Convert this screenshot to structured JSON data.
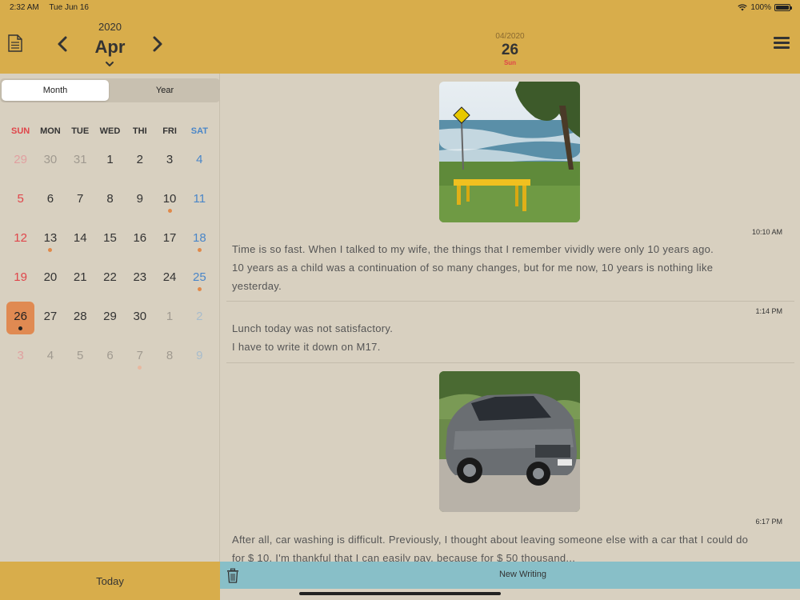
{
  "status_bar": {
    "time": "2:32 AM",
    "date": "Tue Jun 16",
    "battery": "100%",
    "battery_level": 1.0
  },
  "calendar": {
    "year": "2020",
    "month": "Apr",
    "segments": [
      "Month",
      "Year"
    ],
    "active_segment": "Month",
    "weekdays": [
      "SUN",
      "MON",
      "TUE",
      "WED",
      "THI",
      "FRI",
      "SAT"
    ],
    "weeks": [
      [
        {
          "d": "29",
          "o": true
        },
        {
          "d": "30",
          "o": true
        },
        {
          "d": "31",
          "o": true
        },
        {
          "d": "1"
        },
        {
          "d": "2"
        },
        {
          "d": "3"
        },
        {
          "d": "4"
        }
      ],
      [
        {
          "d": "5"
        },
        {
          "d": "6"
        },
        {
          "d": "7"
        },
        {
          "d": "8"
        },
        {
          "d": "9"
        },
        {
          "d": "10",
          "dot": true
        },
        {
          "d": "11"
        }
      ],
      [
        {
          "d": "12"
        },
        {
          "d": "13",
          "dot": true
        },
        {
          "d": "14"
        },
        {
          "d": "15"
        },
        {
          "d": "16"
        },
        {
          "d": "17"
        },
        {
          "d": "18",
          "dot": true
        }
      ],
      [
        {
          "d": "19"
        },
        {
          "d": "20"
        },
        {
          "d": "21"
        },
        {
          "d": "22"
        },
        {
          "d": "23"
        },
        {
          "d": "24"
        },
        {
          "d": "25",
          "dot": true
        }
      ],
      [
        {
          "d": "26",
          "dot": true,
          "sel": true
        },
        {
          "d": "27"
        },
        {
          "d": "28"
        },
        {
          "d": "29"
        },
        {
          "d": "30"
        },
        {
          "d": "1",
          "o": true
        },
        {
          "d": "2",
          "o": true
        }
      ],
      [
        {
          "d": "3",
          "o": true
        },
        {
          "d": "4",
          "o": true
        },
        {
          "d": "5",
          "o": true
        },
        {
          "d": "6",
          "o": true
        },
        {
          "d": "7",
          "o": true,
          "dot": true
        },
        {
          "d": "8",
          "o": true
        },
        {
          "d": "9",
          "o": true
        }
      ]
    ],
    "today_label": "Today"
  },
  "header": {
    "date_small": "04/2020",
    "date_big": "26",
    "day": "Sun"
  },
  "entries": [
    {
      "time": "10:10 AM",
      "text_lines": [
        "Time is so fast. When I talked to my wife, the things that I remember vividly were only 10 years ago.",
        "10 years as a child was a continuation of so many changes, but for me now, 10 years is nothing like",
        "yesterday."
      ]
    },
    {
      "time": "1:14 PM",
      "text_lines": [
        "Lunch today was not satisfactory.",
        "I have to write it down on M17."
      ]
    },
    {
      "time": "6:17 PM",
      "text_lines": [
        "After all, car washing is difficult. Previously, I thought about leaving someone else with a car that I could do",
        "for $ 10. I'm thankful that I can easily pay, because for $ 50 thousand..."
      ]
    }
  ],
  "bottom_bar": {
    "new_writing": "New Writing"
  },
  "colors": {
    "accent": "#d8ad4b",
    "background": "#d8d0c0",
    "selected": "#e08a52",
    "sunday": "#e0454a",
    "saturday": "#4a86c8",
    "bottom_bar": "#88bfc8"
  }
}
